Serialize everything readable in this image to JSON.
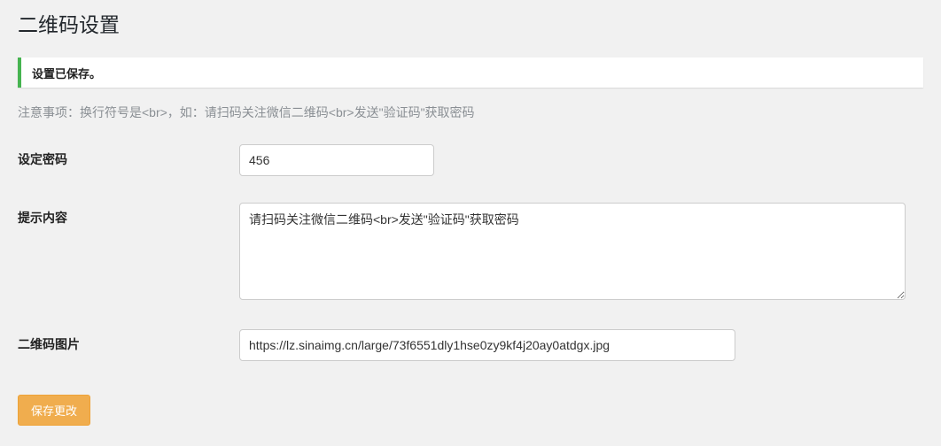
{
  "title": "二维码设置",
  "notice": {
    "message": "设置已保存。"
  },
  "note": "注意事项：换行符号是<br>，如：请扫码关注微信二维码<br>发送\"验证码\"获取密码",
  "form": {
    "password": {
      "label": "设定密码",
      "value": "456"
    },
    "hint": {
      "label": "提示内容",
      "value": "请扫码关注微信二维码<br>发送\"验证码\"获取密码"
    },
    "qrimage": {
      "label": "二维码图片",
      "value": "https://lz.sinaimg.cn/large/73f6551dly1hse0zy9kf4j20ay0atdgx.jpg"
    },
    "submit_label": "保存更改"
  }
}
